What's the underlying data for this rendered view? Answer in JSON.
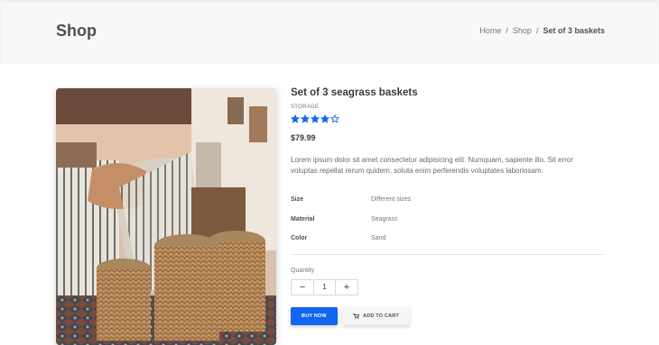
{
  "header": {
    "title": "Shop",
    "breadcrumb": [
      {
        "label": "Home"
      },
      {
        "label": "Shop"
      },
      {
        "label": "Set of 3 baskets"
      }
    ],
    "separator": "/"
  },
  "product": {
    "title": "Set of 3 seagrass baskets",
    "category": "STORAGE",
    "rating": 4,
    "rating_max": 5,
    "star_color": "#1266f1",
    "price": "$79.99",
    "description": "Lorem ipsum dolor sit amet consectetur adipisicing elit. Numquam, sapiente illo. Sit error voluptas repellat rerum quidem, soluta enim perferendis voluptates laboriosam.",
    "specs": [
      {
        "key": "Size",
        "value": "Different sizes"
      },
      {
        "key": "Material",
        "value": "Seagrass"
      },
      {
        "key": "Color",
        "value": "Sand"
      }
    ],
    "quantity_label": "Quantity",
    "quantity": "1",
    "minus": "−",
    "plus": "+"
  },
  "actions": {
    "buy_now": "BUY NOW",
    "add_to_cart": "ADD TO CART",
    "cart_icon": "cart-icon",
    "accent": "#1266f1"
  }
}
